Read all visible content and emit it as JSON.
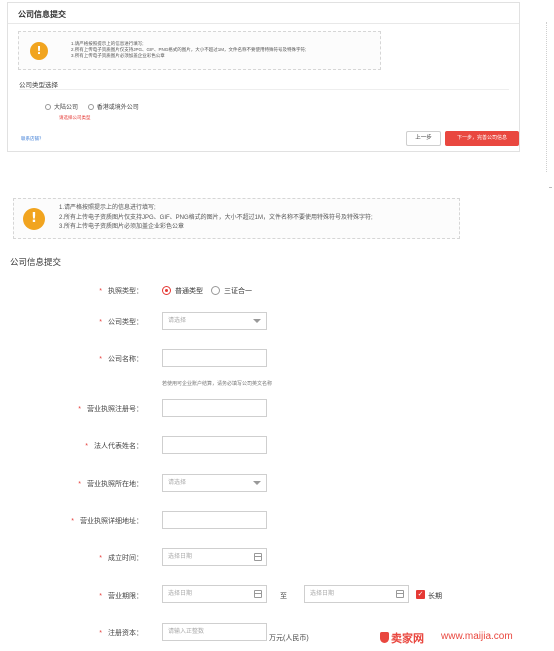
{
  "panel1": {
    "title": "公司信息提交",
    "notice_lines": [
      "1.请严格按照提示上的信息进行填写;",
      "2.所有上传电子资质图片仅支持JPG、GIF、PNG格式的图片，大小不超过1M，文件名称不要使用特殊符号及特殊字符;",
      "3.所有上传电子资质图片必须加盖企业彩色公章"
    ],
    "type_label": "公司类型选择",
    "options": [
      "大陆公司",
      "香港或境外公司"
    ],
    "error": "请选择公司类型",
    "help_link": "联系店铺？",
    "prev_button": "上一步",
    "next_button": "下一步，完善公司信息"
  },
  "panel2": {
    "notice_lines": [
      "1.请严格按照提示上的信息进行填写;",
      "2.所有上传电子资质图片仅支持JPG、GIF、PNG格式的图片，大小不超过1M，文件名称不要使用特殊符号及特殊字符;",
      "3.所有上传电子资质图片必须加盖企业彩色公章"
    ],
    "title": "公司信息提交",
    "required_mark": "*",
    "license_type": {
      "label": "执照类型：",
      "options": [
        "普通类型",
        "三证合一"
      ],
      "selected": "普通类型"
    },
    "company_type": {
      "label": "公司类型：",
      "placeholder": "请选择"
    },
    "company_name": {
      "label": "公司名称：",
      "value": "",
      "hint": "若使用可企业账户结算，请务必填写公司英文名称"
    },
    "reg_number": {
      "label": "营业执照注册号：",
      "value": ""
    },
    "legal_rep": {
      "label": "法人代表姓名：",
      "value": ""
    },
    "license_location": {
      "label": "营业执照所在地：",
      "placeholder": "请选择"
    },
    "license_address": {
      "label": "营业执照详细地址：",
      "value": ""
    },
    "established": {
      "label": "成立时间：",
      "placeholder": "选择日期"
    },
    "business_term": {
      "label": "营业期限：",
      "start_placeholder": "选择日期",
      "to": "至",
      "end_placeholder": "选择日期",
      "long_term_label": "长期",
      "long_term_checked": true
    },
    "capital": {
      "label": "注册资本：",
      "placeholder": "请输入正整数",
      "unit": "万元(人民币)"
    }
  },
  "watermark": {
    "logo_text": "卖家网",
    "url": "www.maijia.com"
  },
  "colors": {
    "accent_red": "#e9473f",
    "warning_orange": "#f1a41f",
    "required_red": "#e53935"
  },
  "icons": [
    "warning-icon",
    "chevron-down-icon",
    "calendar-icon",
    "check-icon"
  ]
}
